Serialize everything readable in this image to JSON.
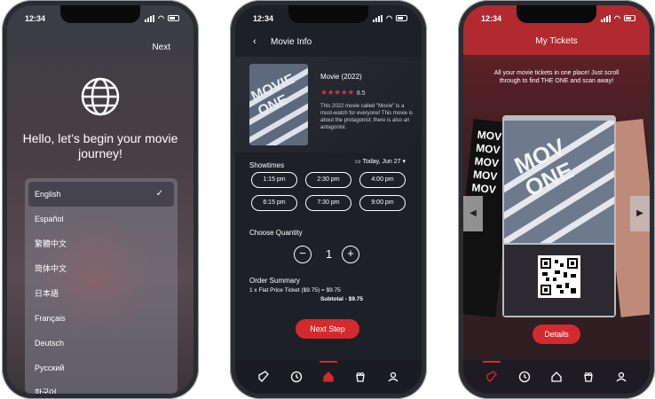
{
  "status": {
    "time": "12:34"
  },
  "phone1": {
    "next_label": "Next",
    "title": "Hello, let’s begin your movie journey!",
    "languages": [
      "English",
      "Español",
      "繁體中文",
      "简体中文",
      "日本語",
      "Français",
      "Deutsch",
      "Русский",
      "한국어"
    ],
    "selected": "English",
    "check_glyph": "✓"
  },
  "phone2": {
    "back_glyph": "‹",
    "header_title": "Movie Info",
    "movie_title": "Movie (2022)",
    "stars": "★★★★★",
    "rating": "8.5",
    "description": "This 2022 movie called \"Movie\" is a must-watch for everyone! This movie is about the protagonist; there is also an antagonist.",
    "poster_text": "MOVIE ONE",
    "showtimes_label": "Showtimes",
    "date_label": "Today, Jun 27 ▾",
    "showtimes": [
      "1:15 pm",
      "2:30 pm",
      "4:00 pm",
      "6:15 pm",
      "7:30 pm",
      "9:00 pm"
    ],
    "quantity_label": "Choose Quantity",
    "minus": "−",
    "plus": "+",
    "quantity": "1",
    "order_label": "Order Summary",
    "order_line": "1 x Flat Price Ticket ($9.75) = $9.75",
    "subtotal": "Subtotal - $9.75",
    "next_step": "Next Step",
    "nav": [
      "ticket-icon",
      "clock-icon",
      "home-icon",
      "popcorn-icon",
      "profile-icon"
    ],
    "active_nav": "home-icon"
  },
  "phone3": {
    "title": "My Tickets",
    "subtitle": "All your movie tickets in one place! Just scroll through to find THE ONE and scan away!",
    "ticket_text": "MOV ONE",
    "side_text": "MOV MOV MOV MOV MOV",
    "left_arrow": "◀",
    "right_arrow": "▶",
    "details": "Details",
    "nav": [
      "ticket-icon",
      "clock-icon",
      "home-icon",
      "popcorn-icon",
      "profile-icon"
    ],
    "active_nav": "ticket-icon"
  },
  "colors": {
    "accent": "#d32a2f",
    "dark_bg": "#1e2027",
    "tickets_header": "#b02a2f"
  }
}
